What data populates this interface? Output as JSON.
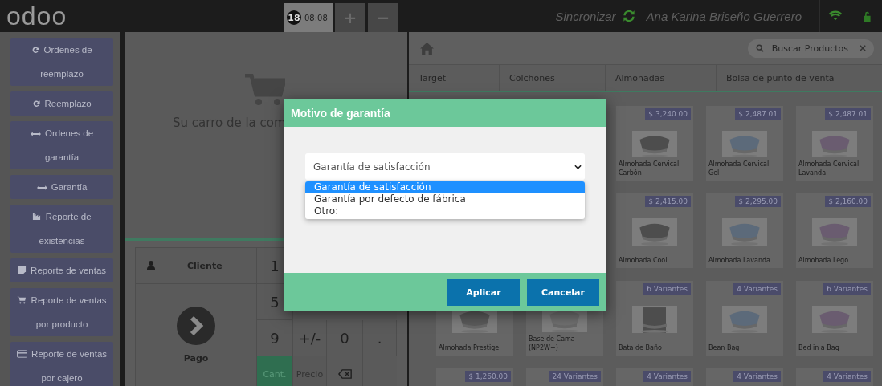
{
  "top_bar": {
    "logo": "odoo",
    "order_tab": {
      "number": "18",
      "time": "08:08",
      "selected": true
    },
    "buttons": [
      "+",
      "−"
    ],
    "sync_label": "Sincronizar",
    "user": "Ana Karina Briseño Guerrero"
  },
  "sidebar": {
    "items": [
      {
        "kind": "replace",
        "label": "Ordenes de reemplazo"
      },
      {
        "kind": "replace",
        "label": "Reemplazo"
      },
      {
        "kind": "warranty",
        "label": "Ordenes de garantía"
      },
      {
        "kind": "warranty",
        "label": "Garantía"
      },
      {
        "kind": "stock",
        "label": "Reporte de existencias"
      },
      {
        "kind": "sales",
        "label": "Reporte de ventas"
      },
      {
        "kind": "cart",
        "label": "Reporte de ventas por producto"
      },
      {
        "kind": "card",
        "label": "Reporte de ventas por cajero"
      }
    ]
  },
  "cart": {
    "empty_message": "Su carro de la com"
  },
  "actions": {
    "customer": "Cliente",
    "payment": "Pago"
  },
  "numpad": [
    [
      {
        "kind": "key",
        "label": "1"
      }
    ],
    [
      {
        "kind": "key",
        "label": "5"
      }
    ],
    [
      {
        "kind": "key",
        "label": "9"
      },
      {
        "kind": "key",
        "label": "+/-"
      },
      {
        "kind": "key",
        "label": "0"
      },
      {
        "kind": "key",
        "label": "."
      }
    ],
    [
      {
        "kind": "mode",
        "label": "Cant.",
        "selected": true
      },
      {
        "kind": "mode",
        "label": "Precio",
        "selected": false
      },
      {
        "kind": "backspace"
      }
    ]
  ],
  "search": {
    "placeholder": "Buscar Productos"
  },
  "categories": [
    "Target",
    "Colchones",
    "Almohadas",
    "Bolsa de punto de venta"
  ],
  "products": [
    [
      {
        "badge": "$ 3,240.00",
        "name": "Almohada Cervical Carbón"
      },
      {
        "badge": "$ 2,487.01",
        "name": "Almohada Cervical Gel"
      },
      {
        "badge": "$ 2,487.01",
        "name": "Almohada Cervical Lavanda"
      }
    ],
    [
      {
        "badge": "$ 2,415.00",
        "name": "Almohada Cool"
      },
      {
        "badge": "$ 2,295.00",
        "name": "Almohada Lavanda"
      },
      {
        "badge": "$ 2,160.00",
        "name": "Almohada Lego"
      }
    ],
    [
      {
        "name": "Almohada Prestige"
      },
      {
        "name": "Base de Cama (NP2W+)"
      },
      {
        "badge": "6 Variantes",
        "name": "Bata de Baño"
      },
      {
        "badge": "4 Variantes",
        "name": "Bean Bag"
      },
      {
        "badge": "6 Variantes",
        "name": "Bed in a Bag"
      }
    ],
    [
      {
        "badge": "$ 1,260.00"
      },
      {
        "badge": "24 Variantes"
      },
      {
        "badge": "4 Variantes"
      },
      {
        "badge": "4 Variantes"
      },
      {
        "badge": "4 Variantes"
      }
    ]
  ],
  "dialog": {
    "title": "Motivo de garantía",
    "select": {
      "value": "Garantía de satisfacción",
      "options": [
        {
          "label": "Garantía de satisfacción",
          "selected": true
        },
        {
          "label": "Garantía por defecto de fábrica",
          "selected": false
        },
        {
          "label": "Otro:",
          "selected": false
        }
      ]
    },
    "buttons": [
      "Aplicar",
      "Cancelar"
    ]
  }
}
